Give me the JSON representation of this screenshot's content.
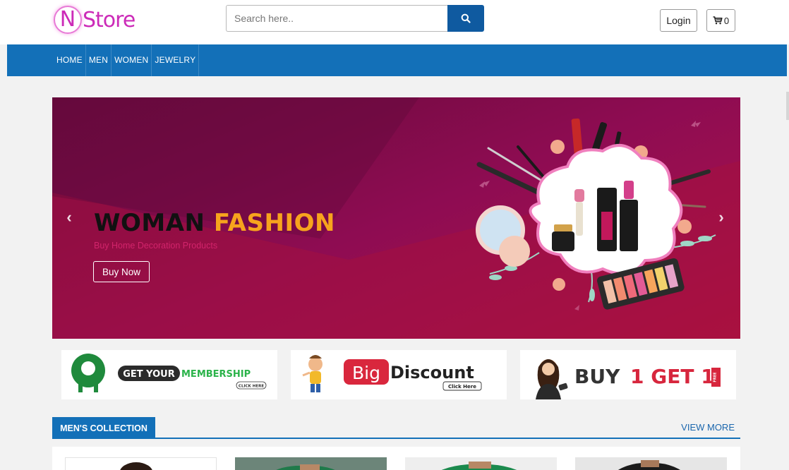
{
  "header": {
    "logo_letter": "N",
    "logo_text": "Store",
    "search_placeholder": "Search here..",
    "login_label": "Login",
    "cart_count": "0"
  },
  "nav": {
    "items": [
      {
        "label": "HOME"
      },
      {
        "label": "MEN"
      },
      {
        "label": "WOMEN"
      },
      {
        "label": "JEWELRY"
      }
    ]
  },
  "banner": {
    "title_part1": "WOMAN",
    "title_part2": "FASHION",
    "subtitle": "Buy Home Decoration Products",
    "button_label": "Buy Now",
    "prev_icon": "chevron-left-icon",
    "next_icon": "chevron-right-icon"
  },
  "promos": [
    {
      "text_a": "GET YOUR",
      "text_b": "MEMBERSHIP",
      "cta": "CLICK HERE"
    },
    {
      "text_a": "Big",
      "text_b": "Discount",
      "cta": "Click Here"
    },
    {
      "text_a": "BUY",
      "text_b": "1 GET 1",
      "tag": "FREE"
    }
  ],
  "mens_section": {
    "title": "MEN'S COLLECTION",
    "view_more": "VIEW MORE"
  },
  "colors": {
    "brand_pink": "#cc2bb8",
    "nav_blue": "#1370b8",
    "search_blue": "#0f5aa0",
    "banner_magenta": "#8e0c52",
    "accent_gold": "#f7a41d"
  }
}
